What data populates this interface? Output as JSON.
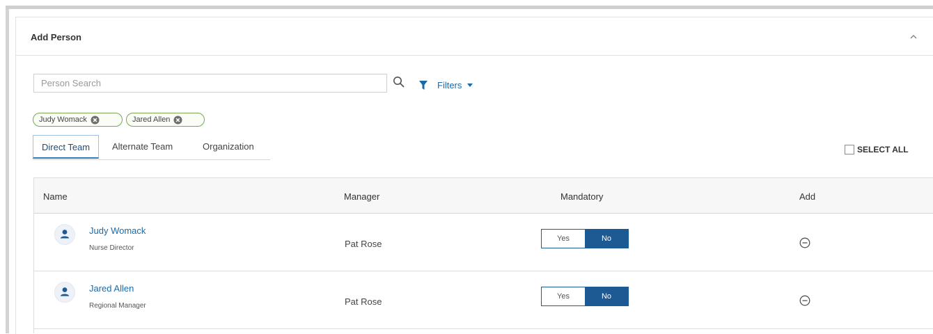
{
  "panel": {
    "title": "Add Person",
    "collapse_icon": "chevron-up-icon"
  },
  "search": {
    "placeholder": "Person Search",
    "value": "",
    "search_icon": "search-icon",
    "filters_label": "Filters",
    "filter_icon": "filter-icon",
    "caret_icon": "caret-down-icon"
  },
  "chips": [
    {
      "label": "Judy Womack",
      "close_icon": "close-circle-icon"
    },
    {
      "label": "Jared Allen",
      "close_icon": "close-circle-icon"
    }
  ],
  "tabs": [
    {
      "label": "Direct Team",
      "active": true
    },
    {
      "label": "Alternate Team",
      "active": false
    },
    {
      "label": "Organization",
      "active": false
    }
  ],
  "select_all": {
    "label": "SELECT ALL",
    "checked": false
  },
  "table": {
    "headers": {
      "name": "Name",
      "manager": "Manager",
      "mandatory": "Mandatory",
      "add": "Add"
    },
    "rows": [
      {
        "name": "Judy Womack",
        "title": "Nurse Director",
        "manager": "Pat Rose",
        "yes_label": "Yes",
        "no_label": "No",
        "selected": "No",
        "avatar_icon": "person-icon",
        "action_icon": "minus-circle-icon"
      },
      {
        "name": "Jared Allen",
        "title": "Regional Manager",
        "manager": "Pat Rose",
        "yes_label": "Yes",
        "no_label": "No",
        "selected": "No",
        "avatar_icon": "person-icon",
        "action_icon": "minus-circle-icon"
      }
    ]
  },
  "colors": {
    "link": "#1b6aa8",
    "toggle_active": "#1d5a94",
    "chip_border": "#7aa655",
    "tab_active_border": "#2f7cc0"
  }
}
